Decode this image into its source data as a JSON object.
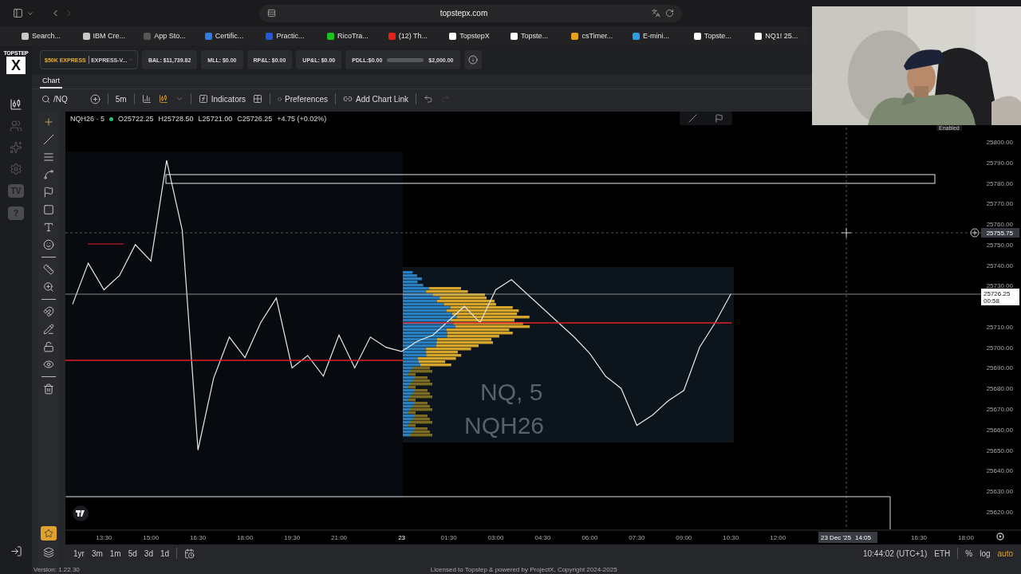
{
  "browser": {
    "url": "topstepx.com",
    "bookmarks": [
      {
        "label": "Search...",
        "color": "#c8c8c8"
      },
      {
        "label": "IBM Cre...",
        "color": "#c8c8c8"
      },
      {
        "label": "App Sto...",
        "color": "#555555"
      },
      {
        "label": "Certific...",
        "color": "#2f7de1"
      },
      {
        "label": "Practic...",
        "color": "#2458d6"
      },
      {
        "label": "RicoTra...",
        "color": "#19c21e"
      },
      {
        "label": "(12) Th...",
        "color": "#e62117"
      },
      {
        "label": "TopstepX",
        "color": "#ffffff"
      },
      {
        "label": "Topste...",
        "color": "#ffffff"
      },
      {
        "label": "csTimer...",
        "color": "#e5a21a"
      },
      {
        "label": "E-mini...",
        "color": "#2aa0e0"
      },
      {
        "label": "Topste...",
        "color": "#ffffff"
      },
      {
        "label": "NQ1! 25...",
        "color": "#ffffff"
      }
    ]
  },
  "rail": {
    "logo_top": "TOPSTEP",
    "logo_mark": "X",
    "badges": [
      "TV",
      "?"
    ]
  },
  "account": {
    "name": "$50K EXPRESS",
    "id": "EXPRESS-V...",
    "stats": [
      "BAL: $11,739.82",
      "MLL: $0.00",
      "RP&L: $0.00",
      "UP&L: $0.00"
    ],
    "pdll": {
      "label": "PDLL:$0.00",
      "level": 0,
      "limit": "$2,000.00"
    }
  },
  "tabs": [
    {
      "label": "Chart",
      "selected": true
    }
  ],
  "toolbar": {
    "symbol": "/NQ",
    "interval": "5m",
    "indicators": "Indicators",
    "preferences": "Preferences",
    "chart_link": "Add Chart Link",
    "redo": {
      "disabled": true
    }
  },
  "legend": {
    "symbol": "NQH26 · 5",
    "live": true,
    "ohlc": [
      "O25722.25",
      "H25728.50",
      "L25721.00",
      "C25726.25"
    ],
    "change": "+4.75 (+0.02%)"
  },
  "chart": {
    "watermark": [
      "NQ, 5",
      "NQH26"
    ],
    "crosshair": {
      "price": "25755.75",
      "date": "23 Dec '25",
      "time": "14:05"
    },
    "last_price": {
      "price": "25726.25",
      "countdown": "00:58"
    },
    "chart_data": {
      "type": "line",
      "ylim": [
        25611,
        25807
      ],
      "categories": [
        null,
        null,
        "13:30",
        null,
        null,
        "15:00",
        null,
        null,
        "16:30",
        null,
        null,
        "18:00",
        null,
        null,
        "19:30",
        null,
        null,
        "21:00",
        null,
        null,
        null,
        "23",
        null,
        null,
        "01:30",
        null,
        null,
        "03:00",
        null,
        null,
        "04:30",
        null,
        null,
        "06:00",
        null,
        null,
        "07:30",
        null,
        null,
        "09:00",
        null,
        null,
        "10:30",
        null,
        null,
        "12:00",
        null,
        null,
        null,
        null,
        null,
        null,
        null,
        null,
        "16:30",
        null,
        null,
        "18:00"
      ],
      "series": [
        {
          "color": "#e8e8e8",
          "values": [
            25721,
            25741,
            25728,
            25735,
            25750,
            25742,
            25791,
            25757,
            25650,
            25685,
            25705,
            25695,
            25712,
            25724,
            25690,
            25696,
            25686,
            25706,
            25690,
            25705,
            25700,
            25698,
            25703,
            25706,
            25713,
            25720,
            25712,
            25728,
            25733,
            25726,
            25719,
            25712,
            25705,
            25697,
            25686,
            25680,
            25662,
            25667,
            25674,
            25679,
            25700,
            25712,
            25726,
            null,
            null,
            null,
            null,
            null,
            null,
            null,
            null,
            null,
            null,
            null,
            null,
            null,
            null,
            null
          ]
        }
      ],
      "yticks": [
        {
          "value": 25800,
          "label": "25800.00"
        },
        {
          "value": 25790,
          "label": "25790.00"
        },
        {
          "value": 25780,
          "label": "25780.00"
        },
        {
          "value": 25770,
          "label": "25770.00"
        },
        {
          "value": 25760,
          "label": "25760.00"
        },
        {
          "value": 25750,
          "label": "25750.00"
        },
        {
          "value": 25740,
          "label": "25740.00"
        },
        {
          "value": 25730,
          "label": "25730.00"
        },
        {
          "value": 25710,
          "label": "25710.00"
        },
        {
          "value": 25700,
          "label": "25700.00"
        },
        {
          "value": 25690,
          "label": "25690.00"
        },
        {
          "value": 25680,
          "label": "25680.00"
        },
        {
          "value": 25670,
          "label": "25670.00"
        },
        {
          "value": 25660,
          "label": "25660.00"
        },
        {
          "value": 25650,
          "label": "25650.00"
        },
        {
          "value": 25640,
          "label": "25640.00"
        },
        {
          "value": 25630,
          "label": "25630.00"
        },
        {
          "value": 25620,
          "label": "25620.00"
        }
      ]
    }
  },
  "ranges": [
    "1yr",
    "3m",
    "1m",
    "5d",
    "3d",
    "1d"
  ],
  "clock": "10:44:02 (UTC+1)",
  "session": "ETH",
  "scale_options": [
    {
      "label": "%",
      "selected": false
    },
    {
      "label": "log",
      "selected": false
    },
    {
      "label": "auto",
      "selected": true
    }
  ],
  "footer": {
    "version": "Version: 1.22.30",
    "license": "Licensed to Topstep & powered by ProjectX, Copyright 2024-2025"
  },
  "webcam": {
    "kind": "picture",
    "caption": "Enabled"
  }
}
